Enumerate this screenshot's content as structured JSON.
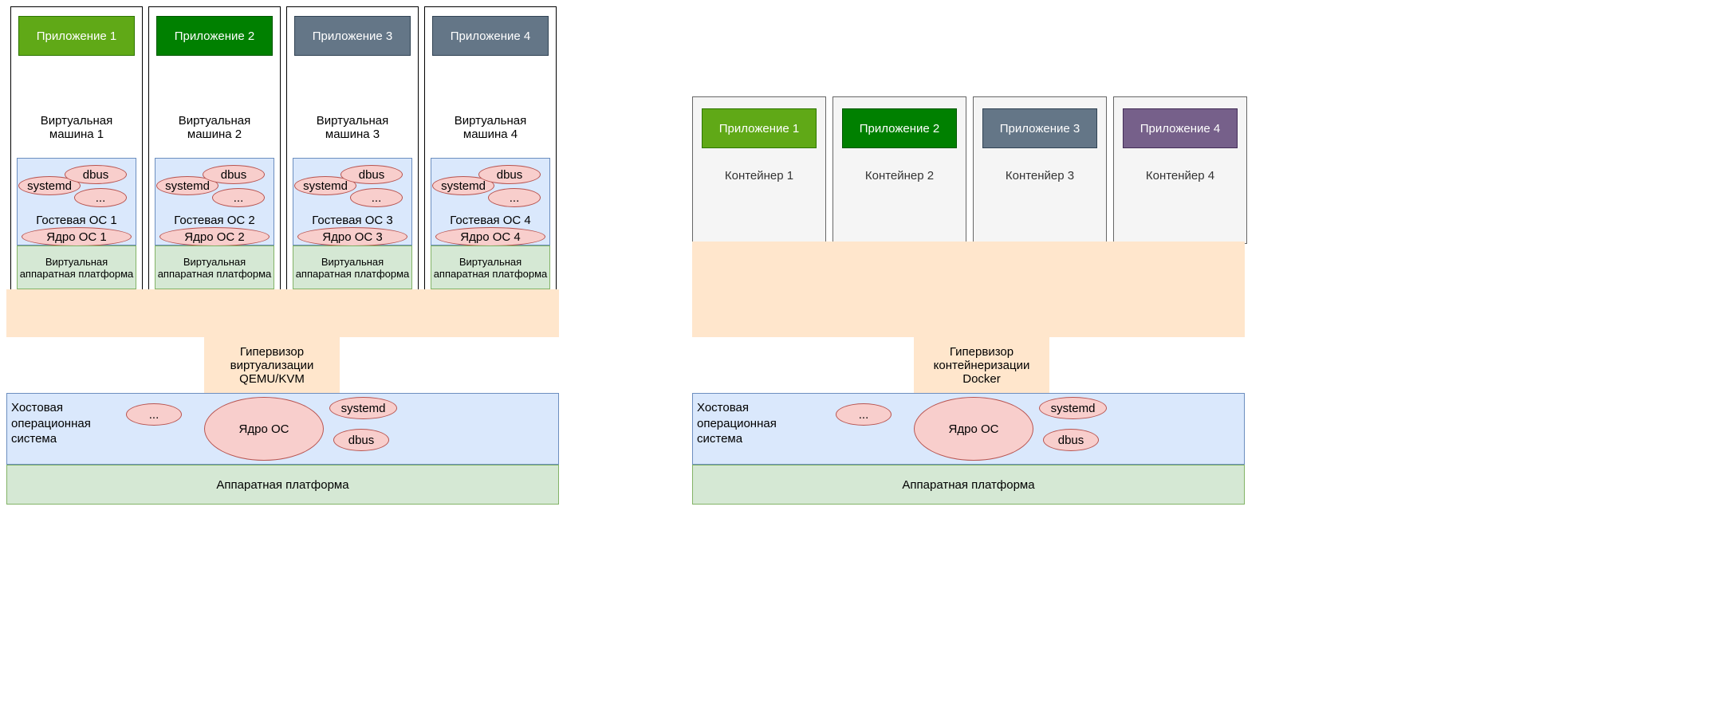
{
  "left": {
    "vms": [
      {
        "app": "Приложение 1",
        "vm": "Виртуальная машина 1",
        "guest": "Гостевая ОС 1",
        "kernel": "Ядро ОС 1",
        "systemd": "systemd",
        "dbus": "dbus",
        "dots": "...",
        "vhw": "Виртуальная аппаратная платформа",
        "appClass": "app1"
      },
      {
        "app": "Приложение 2",
        "vm": "Виртуальная машина 2",
        "guest": "Гостевая ОС 2",
        "kernel": "Ядро ОС 2",
        "systemd": "systemd",
        "dbus": "dbus",
        "dots": "...",
        "vhw": "Виртуальная аппаратная платформа",
        "appClass": "app2"
      },
      {
        "app": "Приложение 3",
        "vm": "Виртуальная машина 3",
        "guest": "Гостевая ОС 3",
        "kernel": "Ядро ОС 3",
        "systemd": "systemd",
        "dbus": "dbus",
        "dots": "...",
        "vhw": "Виртуальная аппаратная платформа",
        "appClass": "app3"
      },
      {
        "app": "Приложение 4",
        "vm": "Виртуальная машина 4",
        "guest": "Гостевая ОС 4",
        "kernel": "Ядро ОС 4",
        "systemd": "systemd",
        "dbus": "dbus",
        "dots": "...",
        "vhw": "Виртуальная аппаратная платформа",
        "appClass": "app3"
      }
    ],
    "hyp": "Гипервизор виртуализации QEMU/KVM",
    "host_label": "Хостовая операционная система",
    "kernel": "Ядро ОС",
    "systemd": "systemd",
    "dbus": "dbus",
    "dots": "...",
    "hw": "Аппаратная платформа"
  },
  "right": {
    "containers": [
      {
        "app": "Приложение 1",
        "name": "Контейнер 1",
        "appClass": "app1"
      },
      {
        "app": "Приложение 2",
        "name": "Контейнер 2",
        "appClass": "app2"
      },
      {
        "app": "Приложение 3",
        "name": "Контенйер 3",
        "appClass": "app3"
      },
      {
        "app": "Приложение 4",
        "name": "Контенйер 4",
        "appClass": "app4"
      }
    ],
    "hyp": "Гипервизор контейнеризации Docker",
    "host_label": "Хостовая операционная система",
    "kernel": "Ядро ОС",
    "systemd": "systemd",
    "dbus": "dbus",
    "dots": "...",
    "hw": "Аппаратная платформа"
  }
}
